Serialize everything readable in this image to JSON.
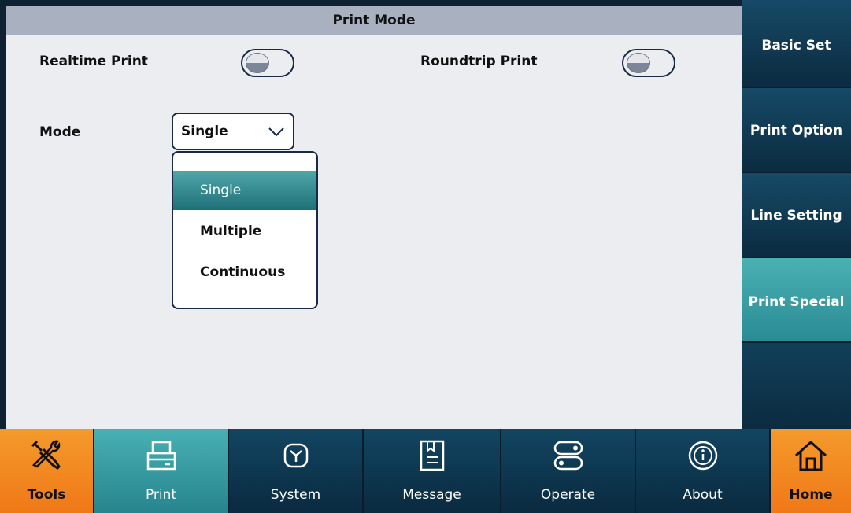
{
  "main": {
    "title": "Print Mode",
    "realtime_label": "Realtime Print",
    "roundtrip_label": "Roundtrip Print",
    "mode_label": "Mode",
    "mode_selected": "Single",
    "mode_options": [
      "Single",
      "Multiple",
      "Continuous"
    ]
  },
  "side": {
    "items": [
      {
        "label": "Basic Set"
      },
      {
        "label": "Print Option"
      },
      {
        "label": "Line Setting"
      },
      {
        "label": "Print Special"
      }
    ]
  },
  "bottom": {
    "tabs": [
      {
        "label": "Tools",
        "icon": "tools-icon"
      },
      {
        "label": "Print",
        "icon": "printer-icon"
      },
      {
        "label": "System",
        "icon": "system-icon"
      },
      {
        "label": "Message",
        "icon": "message-icon"
      },
      {
        "label": "Operate",
        "icon": "operate-icon"
      },
      {
        "label": "About",
        "icon": "info-icon"
      },
      {
        "label": "Home",
        "icon": "home-icon"
      }
    ]
  },
  "colors": {
    "accent_teal": "#2a8b94",
    "accent_orange": "#f07817",
    "nav_blue": "#0b2b40"
  }
}
